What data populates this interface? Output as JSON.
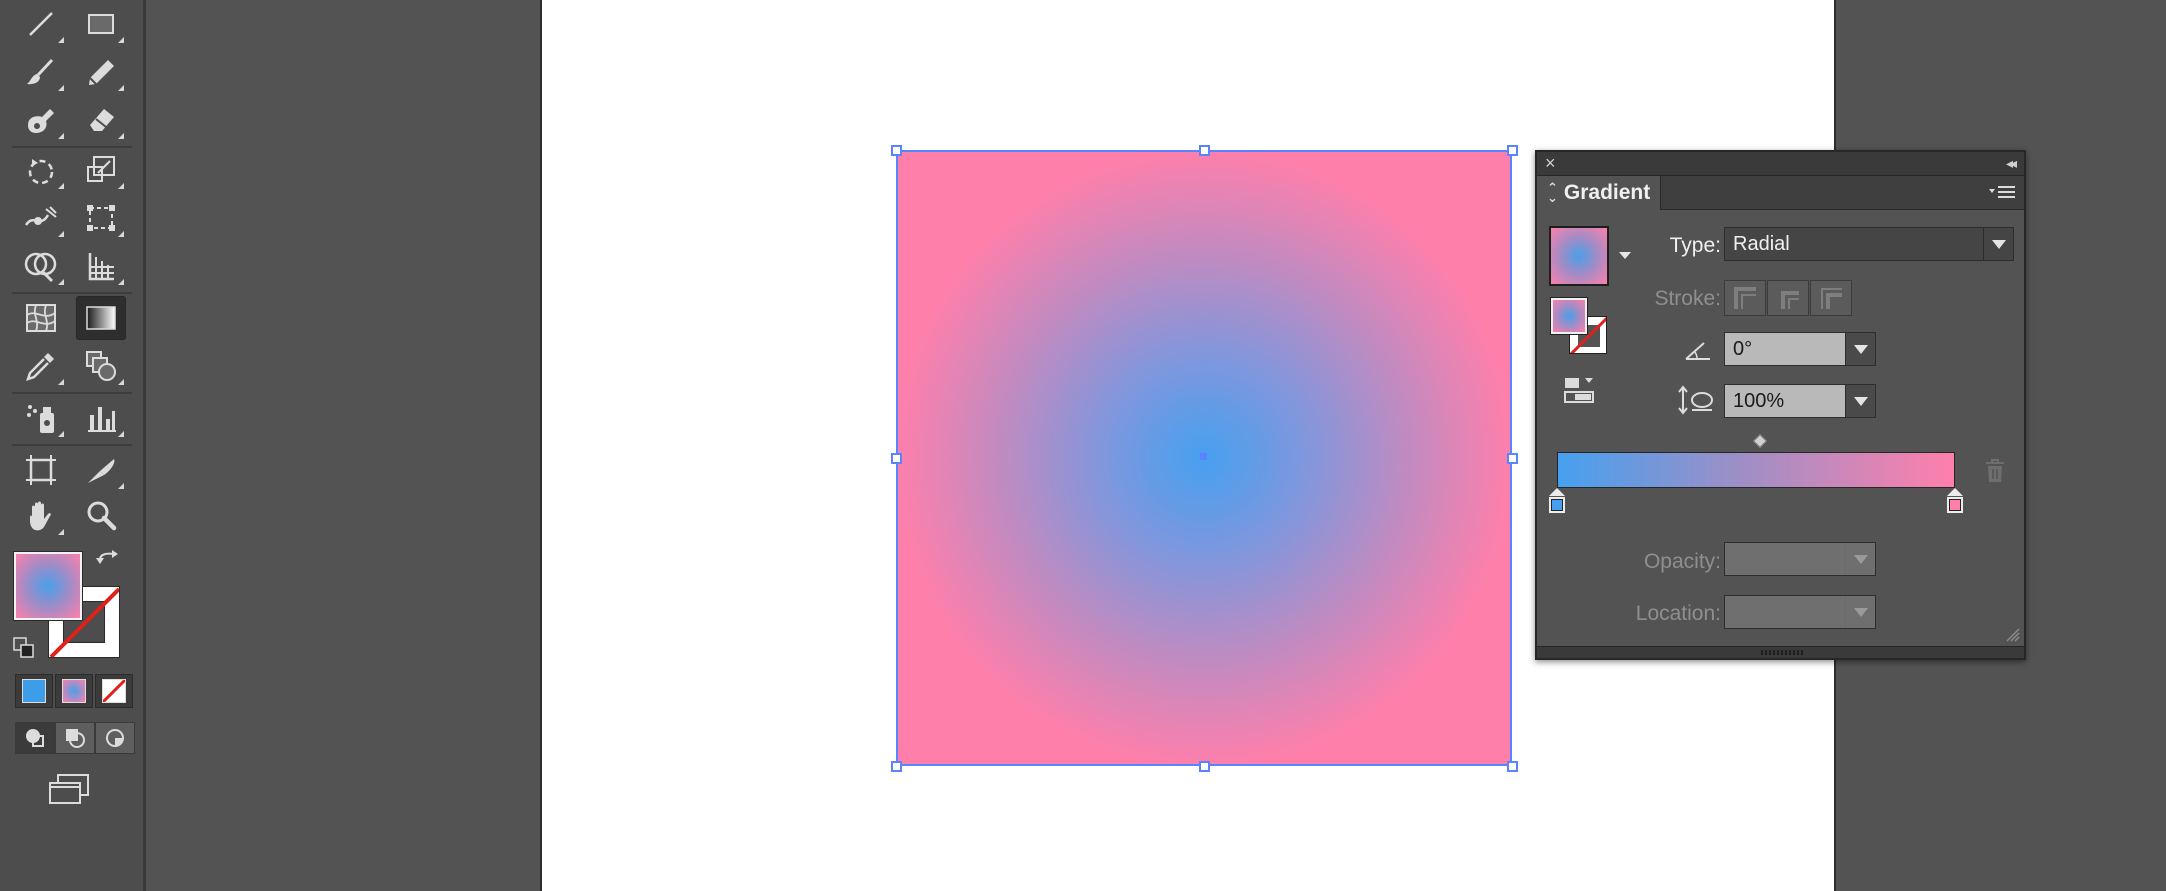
{
  "window": {
    "theme_colors": {
      "workspace": "#535353",
      "toolbar": "#4d4d4d",
      "artboard": "#ffffff",
      "selection": "#5b82ff"
    }
  },
  "toolbar": {
    "tools": [
      {
        "name": "line-segment-tool",
        "icon": "line-icon"
      },
      {
        "name": "rectangle-tool",
        "icon": "rectangle-icon"
      },
      {
        "name": "paintbrush-tool",
        "icon": "brush-icon"
      },
      {
        "name": "pencil-tool",
        "icon": "pencil-icon"
      },
      {
        "name": "blob-brush-tool",
        "icon": "blob-brush-icon"
      },
      {
        "name": "eraser-tool",
        "icon": "eraser-icon"
      },
      {
        "name": "rotate-tool",
        "icon": "rotate-icon"
      },
      {
        "name": "scale-tool",
        "icon": "scale-icon"
      },
      {
        "name": "width-tool",
        "icon": "width-icon"
      },
      {
        "name": "free-transform-tool",
        "icon": "free-transform-icon"
      },
      {
        "name": "shape-builder-tool",
        "icon": "shape-builder-icon"
      },
      {
        "name": "perspective-grid-tool",
        "icon": "perspective-grid-icon"
      },
      {
        "name": "mesh-tool",
        "icon": "mesh-icon"
      },
      {
        "name": "gradient-tool",
        "icon": "gradient-icon",
        "active": true
      },
      {
        "name": "eyedropper-tool",
        "icon": "eyedropper-icon"
      },
      {
        "name": "blend-tool",
        "icon": "blend-icon"
      },
      {
        "name": "symbol-sprayer-tool",
        "icon": "symbol-sprayer-icon"
      },
      {
        "name": "column-graph-tool",
        "icon": "column-graph-icon"
      },
      {
        "name": "artboard-tool",
        "icon": "artboard-icon"
      },
      {
        "name": "slice-tool",
        "icon": "slice-icon"
      },
      {
        "name": "hand-tool",
        "icon": "hand-icon"
      },
      {
        "name": "zoom-tool",
        "icon": "zoom-icon"
      }
    ],
    "fill": {
      "type": "radial-gradient",
      "colors": [
        "#4aa0ea",
        "#ff7fab"
      ]
    },
    "stroke": {
      "type": "none"
    },
    "color_modes": [
      "color",
      "gradient",
      "none"
    ],
    "mode_colors": {
      "color": "#3d9de8",
      "gradient_from": "#4aa0ea",
      "gradient_to": "#ff7fab",
      "none_slash": "#e0201c"
    }
  },
  "canvas": {
    "object": {
      "fill": "radial-gradient",
      "gradient_center_color": "#46a0ef",
      "gradient_edge_color": "#ff7fab"
    }
  },
  "gradient_panel": {
    "title": "Gradient",
    "type_label": "Type:",
    "type_value": "Radial",
    "stroke_label": "Stroke:",
    "angle_value": "0°",
    "aspect_value": "100%",
    "opacity_label": "Opacity:",
    "opacity_value": "",
    "location_label": "Location:",
    "location_value": "",
    "stops": [
      {
        "color": "#46a0ef",
        "location_percent": 0
      },
      {
        "color": "#ff7fab",
        "location_percent": 100
      }
    ],
    "midpoint_percent": 50
  }
}
